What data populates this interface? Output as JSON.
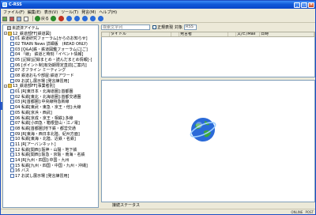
{
  "window": {
    "title": "C-RSS"
  },
  "menu": [
    "ファイル(F)",
    "編集(E)",
    "表示(V)",
    "ツール(T)",
    "発言(M)",
    "ヘルプ(H)"
  ],
  "toolbar": {
    "labels": [
      "",
      "",
      "",
      "",
      "戻る",
      "",
      "",
      "",
      ""
    ],
    "back_label": "戻る"
  },
  "tree": [
    {
      "type": "trash",
      "indent": 1,
      "label": "未読済アイテム"
    },
    {
      "type": "folder",
      "indent": 0,
      "label": "12_鉄道部FF[鉄道図]",
      "expander": "-"
    },
    {
      "type": "feed",
      "indent": 2,
      "label": "01 鉄道研究フォーラム[からのお知らせ]"
    },
    {
      "type": "feed",
      "indent": 2,
      "label": "02 TRAIN News 詳細版　(READ ONLY)"
    },
    {
      "type": "feed",
      "indent": 2,
      "label": "03 [Q&A]鉄・鉄道図鑑フォーラムに[ご]"
    },
    {
      "type": "feed",
      "indent": 2,
      "label": "04 「線」 鉄道と時刻「イベント情報]"
    },
    {
      "type": "feed",
      "indent": 2,
      "label": "05 [記録]記録まとめ・読んだまとめ情報[-]"
    },
    {
      "type": "feed",
      "indent": 2,
      "label": "06 [ポイント制]有効期限定直前[ご案内]"
    },
    {
      "type": "feed",
      "indent": 2,
      "label": "07 オフライン ミーティング"
    },
    {
      "type": "feed",
      "indent": 2,
      "label": "08 鉄道おもや部屋:鉄道アワード"
    },
    {
      "type": "feed",
      "indent": 2,
      "label": "09 お試し展示場 [発言練習用]"
    },
    {
      "type": "folder",
      "indent": 0,
      "label": "13_鉄道部FF[事業者別]",
      "expander": "-"
    },
    {
      "type": "feed",
      "indent": 2,
      "label": "01 JR[東日本・北海道圏]:首都圏"
    },
    {
      "type": "feed",
      "indent": 2,
      "label": "02 私鉄[東北・北海道圏]:首都交通圏"
    },
    {
      "type": "feed",
      "indent": 2,
      "label": "03 JR[首都圏]:中央線特急新線"
    },
    {
      "type": "feed",
      "indent": 2,
      "label": "04 私鉄[東武・東急・京王・他]:大線"
    },
    {
      "type": "feed",
      "indent": 2,
      "label": "05 私鉄[京浜・西武]"
    },
    {
      "type": "feed",
      "indent": 2,
      "label": "06 私鉄[京成・京王・相鉄]:多線"
    },
    {
      "type": "feed",
      "indent": 2,
      "label": "07 私鉄[小田急・箱根登山・江ノ電]"
    },
    {
      "type": "feed",
      "indent": 2,
      "label": "08 私鉄[首都圏]地下鉄・都営交通"
    },
    {
      "type": "feed",
      "indent": 2,
      "label": "09 JR[東海・西日本北陸、紀州方面]"
    },
    {
      "type": "feed",
      "indent": 2,
      "label": "10 私鉄[東海・北陸、近鉄・名鉄]"
    },
    {
      "type": "feed",
      "indent": 2,
      "label": "11 JR[アーバンネット]"
    },
    {
      "type": "feed",
      "indent": 2,
      "label": "12 私鉄[関西]:阪神・山陽・地下鉄"
    },
    {
      "type": "feed",
      "indent": 2,
      "label": "13 私鉄[関西]:阪急・京阪・南海・名鉄"
    },
    {
      "type": "feed",
      "indent": 2,
      "label": "14 JR[九州・四国]:中国・九州"
    },
    {
      "type": "feed",
      "indent": 2,
      "label": "15 私鉄[九州・四国・中国・九州・沖縄]"
    },
    {
      "type": "feed",
      "indent": 2,
      "label": "16 バス"
    },
    {
      "type": "feed",
      "indent": 2,
      "label": "17 お試し展示場 [発言練習用]"
    }
  ],
  "search": {
    "placeholder": "検索文字列",
    "checkbox_label": "正規表現",
    "scope_label": "対象",
    "target_value": "RSS"
  },
  "columns": [
    "",
    "タイトル",
    "",
    "発言者",
    "",
    "文/ビ/Mail",
    "日時"
  ],
  "preview_status": "接続ステータス",
  "status": {
    "left": "",
    "right1": "ONLINE",
    "right2": "POST"
  },
  "colors": {
    "title_blue": "#0a46c8",
    "globe_blue": "#2a6ad8",
    "globe_green": "#3ca83c"
  }
}
